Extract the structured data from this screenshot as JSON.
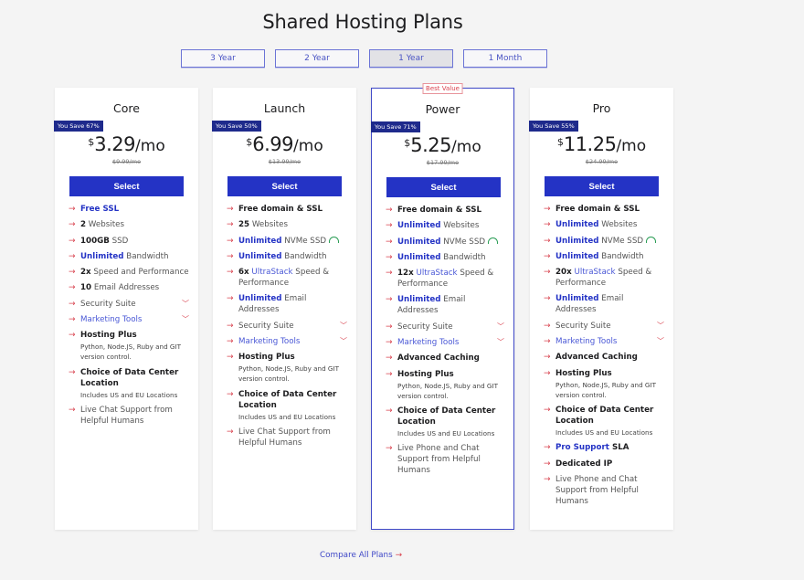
{
  "page_title": "Shared Hosting Plans",
  "term_tabs": [
    {
      "label": "3 Year",
      "active": false
    },
    {
      "label": "2 Year",
      "active": false
    },
    {
      "label": "1 Year",
      "active": true
    },
    {
      "label": "1 Month",
      "active": false
    }
  ],
  "colors": {
    "accent": "#2433c5",
    "arrow": "#d9434f",
    "badge": "#1e2a8c"
  },
  "plans": [
    {
      "name": "Core",
      "save": "You Save 67%",
      "currency": "$",
      "price": "3.29",
      "per": "/mo",
      "old_price": "$9.99/mo",
      "select": "Select",
      "features": {
        "f0": {
          "hl": "Free SSL",
          "rest": ""
        },
        "f1": {
          "bold": "2",
          "rest": " Websites"
        },
        "f2": {
          "bold": "100GB",
          "rest": " SSD"
        },
        "f3": {
          "hl": "Unlimited",
          "rest": " Bandwidth"
        },
        "f4": {
          "bold": "2x",
          "rest": " Speed and Performance"
        },
        "f5": {
          "bold": "10",
          "rest": " Email Addresses"
        },
        "f6": {
          "text": "Security Suite"
        },
        "f7": {
          "text": "Marketing Tools"
        },
        "f8": {
          "title": "Hosting Plus",
          "sub": "Python,  Node.JS,  Ruby and GIT version control."
        },
        "f9": {
          "title": "Choice of Data Center Location",
          "sub": "Includes US and EU Locations"
        },
        "f10": {
          "text": "Live Chat Support from Helpful Humans"
        }
      }
    },
    {
      "name": "Launch",
      "save": "You Save 50%",
      "currency": "$",
      "price": "6.99",
      "per": "/mo",
      "old_price": "$13.99/mo",
      "select": "Select",
      "features": {
        "f0": {
          "bold": "Free domain & SSL"
        },
        "f1": {
          "bold": "25",
          "rest": " Websites"
        },
        "f2": {
          "hl": "Unlimited",
          "rest": " NVMe SSD"
        },
        "f3": {
          "hl": "Unlimited",
          "rest": " Bandwidth"
        },
        "f4": {
          "bold": "6x",
          "lnk": " UltraStack",
          "rest": " Speed & Performance"
        },
        "f5": {
          "hl": "Unlimited",
          "rest": " Email Addresses"
        },
        "f6": {
          "text": "Security Suite"
        },
        "f7": {
          "text": "Marketing Tools"
        },
        "f8": {
          "title": "Hosting Plus",
          "sub": "Python,  Node.JS,  Ruby and GIT version control."
        },
        "f9": {
          "title": "Choice of Data Center Location",
          "sub": "Includes US and EU Locations"
        },
        "f10": {
          "text": "Live Chat Support from Helpful Humans"
        }
      }
    },
    {
      "name": "Power",
      "badge": "Best Value",
      "save": "You Save 71%",
      "currency": "$",
      "price": "5.25",
      "per": "/mo",
      "old_price": "$17.99/mo",
      "select": "Select",
      "features": {
        "f0": {
          "bold": "Free domain & SSL"
        },
        "f1": {
          "hl": "Unlimited",
          "rest": " Websites"
        },
        "f2": {
          "hl": "Unlimited",
          "rest": " NVMe SSD"
        },
        "f3": {
          "hl": "Unlimited",
          "rest": " Bandwidth"
        },
        "f4": {
          "bold": "12x",
          "lnk": " UltraStack",
          "rest": " Speed & Performance"
        },
        "f5": {
          "hl": "Unlimited",
          "rest": " Email Addresses"
        },
        "f6": {
          "text": "Security Suite"
        },
        "f7": {
          "text": "Marketing Tools"
        },
        "f8": {
          "title": "Advanced Caching"
        },
        "f9": {
          "title": "Hosting Plus",
          "sub": "Python,  Node.JS,  Ruby and GIT version control."
        },
        "f10": {
          "title": "Choice of Data Center Location",
          "sub": "Includes US and EU Locations"
        },
        "f11": {
          "text": "Live Phone and Chat Support from Helpful Humans"
        }
      }
    },
    {
      "name": "Pro",
      "save": "You Save 55%",
      "currency": "$",
      "price": "11.25",
      "per": "/mo",
      "old_price": "$24.99/mo",
      "select": "Select",
      "features": {
        "f0": {
          "bold": "Free domain & SSL"
        },
        "f1": {
          "hl": "Unlimited",
          "rest": " Websites"
        },
        "f2": {
          "hl": "Unlimited",
          "rest": " NVMe SSD"
        },
        "f3": {
          "hl": "Unlimited",
          "rest": " Bandwidth"
        },
        "f4": {
          "bold": "20x",
          "lnk": " UltraStack",
          "rest": " Speed & Performance"
        },
        "f5": {
          "hl": "Unlimited",
          "rest": " Email Addresses"
        },
        "f6": {
          "text": "Security Suite"
        },
        "f7": {
          "text": "Marketing Tools"
        },
        "f8": {
          "title": "Advanced Caching"
        },
        "f9": {
          "title": "Hosting Plus",
          "sub": "Python,  Node.JS,  Ruby and GIT version control."
        },
        "f10": {
          "title": "Choice of Data Center Location",
          "sub": "Includes US and EU Locations"
        },
        "f11": {
          "hl": "Pro Support",
          "boldrest": " SLA"
        },
        "f12": {
          "title": "Dedicated IP"
        },
        "f13": {
          "text": "Live Phone and Chat Support from Helpful Humans"
        }
      }
    }
  ],
  "compare_link": "Compare All Plans",
  "arrow_glyph": "→",
  "chevron_glyph": "⌄"
}
